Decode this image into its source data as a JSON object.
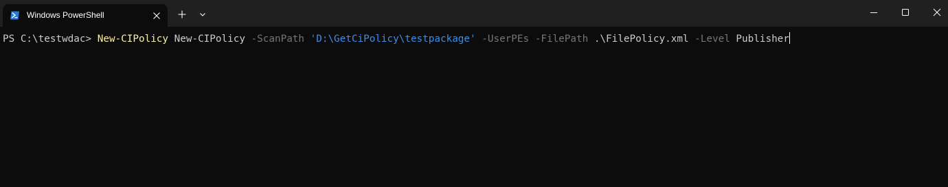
{
  "window": {
    "tab": {
      "title": "Windows PowerShell",
      "icon": "powershell-icon"
    },
    "buttons": {
      "new_tab_icon": "plus-icon",
      "dropdown_icon": "chevron-down-icon",
      "minimize_icon": "minimize-icon",
      "maximize_icon": "maximize-icon",
      "close_icon": "close-icon"
    }
  },
  "terminal": {
    "prompt": "PS C:\\testwdac> ",
    "tokens": {
      "cmdlet": "New-CIPolicy",
      "arg1": " New-CIPolicy ",
      "scanpath_param": "-ScanPath",
      "scanpath_value": "'D:\\GetCiPolicy\\testpackage'",
      "userpes_param": "-UserPEs",
      "filepath_param": "-FilePath",
      "filepath_value": ".\\FilePolicy.xml",
      "level_param": "-Level",
      "level_value": "Publisher"
    }
  },
  "colors": {
    "background": "#0c0c0c",
    "tabbar": "#202020",
    "cmdlet": "#f9f1a5",
    "string": "#3b8eea",
    "parameter": "#767676",
    "text": "#cccccc"
  }
}
